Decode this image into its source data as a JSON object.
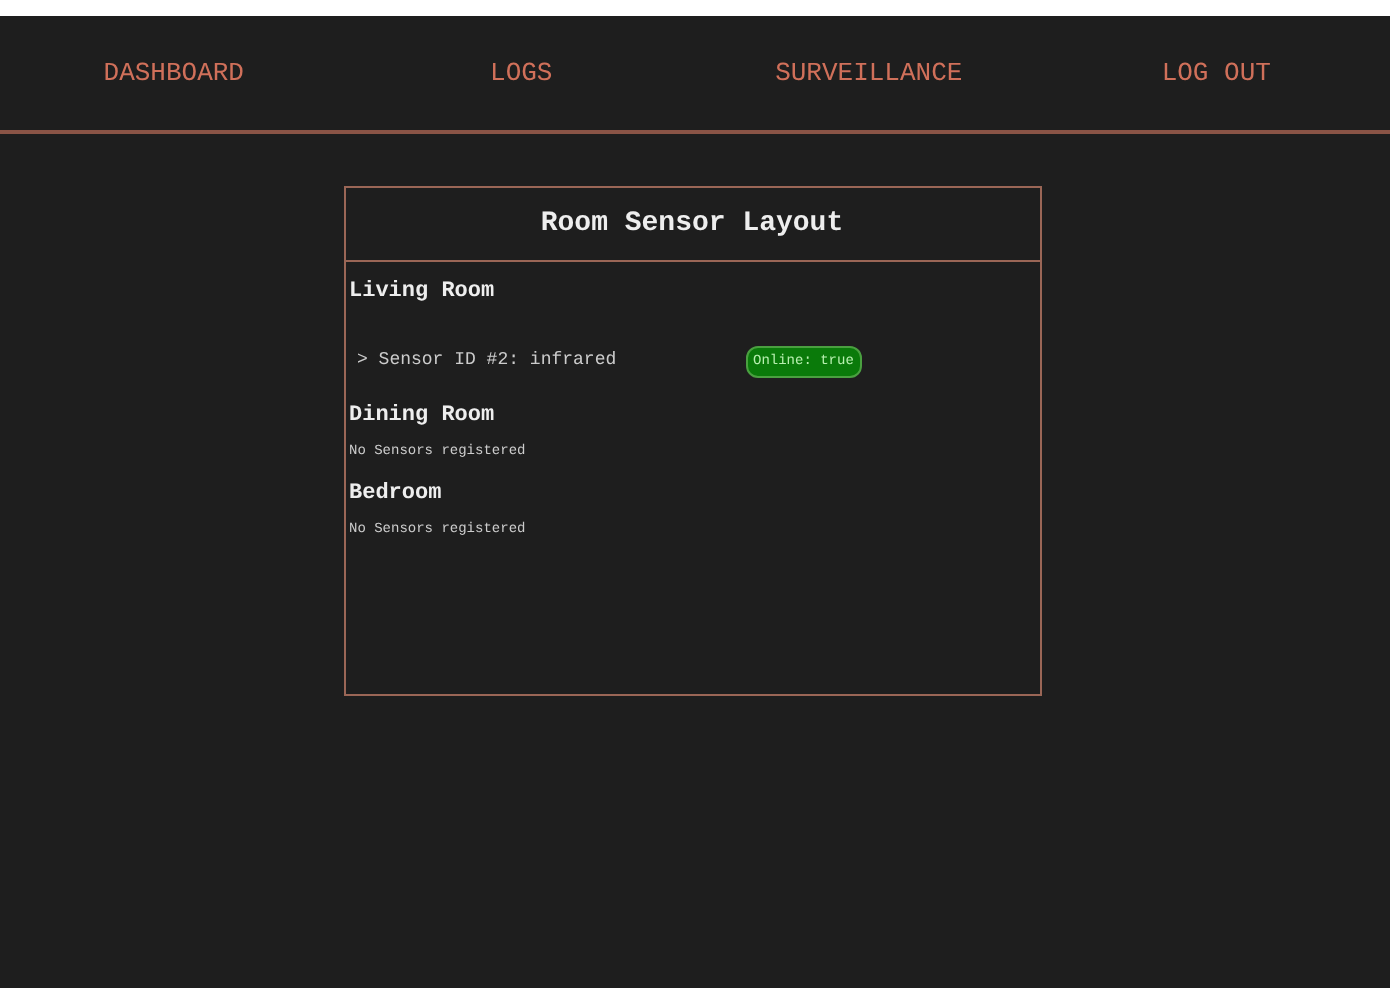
{
  "nav": [
    "DASHBOARD",
    "LOGS",
    "SURVEILLANCE",
    "LOG OUT"
  ],
  "panel": {
    "title": "Room Sensor Layout",
    "rooms": [
      {
        "name": "Living Room",
        "sensors": [
          {
            "label": "> Sensor ID #2: infrared",
            "status": "Online: true",
            "online": true
          }
        ]
      },
      {
        "name": "Dining Room",
        "empty_text": "No Sensors registered"
      },
      {
        "name": "Bedroom",
        "empty_text": "No Sensors registered"
      }
    ]
  }
}
